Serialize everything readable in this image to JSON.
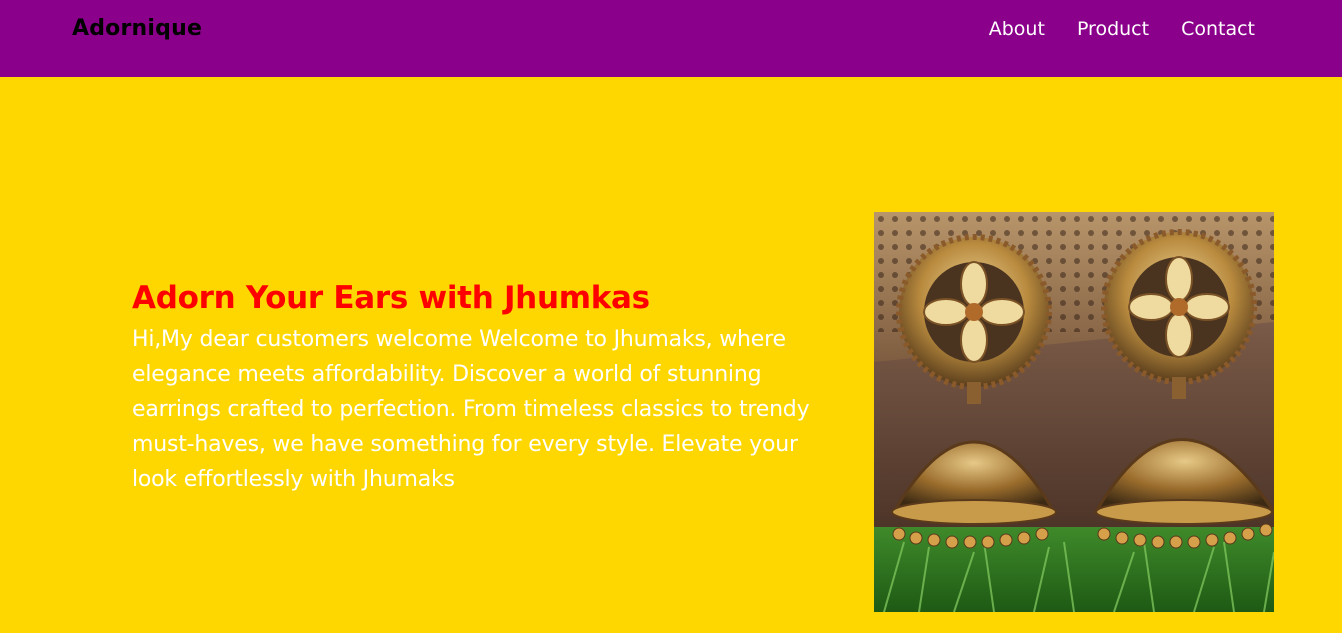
{
  "header": {
    "brand": "Adornique",
    "nav": [
      {
        "label": "About"
      },
      {
        "label": "Product"
      },
      {
        "label": "Contact"
      }
    ]
  },
  "hero": {
    "title": "Adorn Your Ears with Jhumkas",
    "description": "Hi,My dear customers welcome Welcome to Jhumaks, where elegance meets affordability. Discover a world of stunning earrings crafted to perfection. From timeless classics to trendy must-haves, we have something for every style. Elevate your look effortlessly with Jhumaks",
    "image_subject": "pair of gold jhumka earrings on wooden box with grass"
  },
  "colors": {
    "navbar_bg": "#8B008B",
    "page_bg": "#FFD700",
    "title": "#FF0000",
    "text": "#FFFFFF",
    "brand": "#000000"
  }
}
